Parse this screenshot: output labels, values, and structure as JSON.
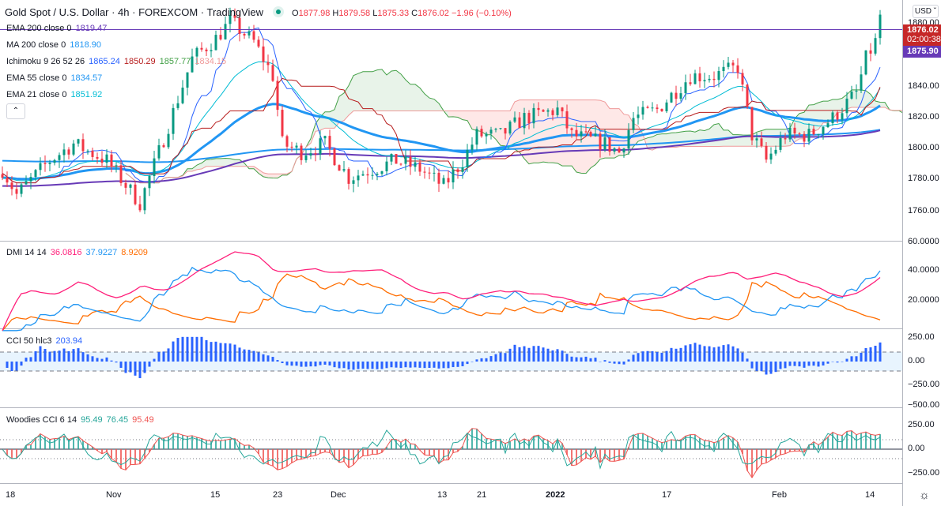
{
  "header": {
    "title": "Gold Spot / U.S. Dollar · 4h · FOREXCOM · TradingView",
    "open_label": "O",
    "open": "1877.98",
    "high_label": "H",
    "high": "1879.58",
    "low_label": "L",
    "low": "1875.33",
    "close_label": "C",
    "close": "1876.02",
    "change": "−1.96 (−0.10%)"
  },
  "legends": {
    "ema200": {
      "name": "EMA 200 close 0",
      "value": "1819.47"
    },
    "ma200": {
      "name": "MA 200 close 0",
      "value": "1818.90"
    },
    "ichimoku": {
      "name": "Ichimoku 9 26 52 26",
      "v1": "1865.24",
      "v2": "1850.29",
      "v3": "1857.77",
      "v4": "1834.15"
    },
    "ema55": {
      "name": "EMA 55 close 0",
      "value": "1834.57"
    },
    "ema21": {
      "name": "EMA 21 close 0",
      "value": "1851.92"
    },
    "dmi": {
      "name": "DMI 14 14",
      "adx": "36.0816",
      "plus_di": "37.9227",
      "minus_di": "8.9209"
    },
    "cci": {
      "name": "CCI 50 hlc3",
      "value": "203.94"
    },
    "woodies": {
      "name": "Woodies CCI 6 14",
      "v1": "95.49",
      "v2": "76.45",
      "v3": "95.49"
    }
  },
  "price_axis": {
    "currency": "USD",
    "ticks": [
      "1880.00",
      "1840.00",
      "1820.00",
      "1800.00",
      "1780.00",
      "1760.00"
    ],
    "last_price": "1876.02",
    "countdown": "02:00:38",
    "ema200_tag": "1875.90"
  },
  "dmi_axis": [
    "60.0000",
    "40.0000",
    "20.0000"
  ],
  "cci_axis": [
    "250.00",
    "0.00",
    "−250.00",
    "−500.00"
  ],
  "woodies_axis": [
    "250.00",
    "0.00",
    "−250.00"
  ],
  "time_axis": [
    "18",
    "Nov",
    "15",
    "23",
    "Dec",
    "13",
    "21",
    "2022",
    "17",
    "Feb",
    "14"
  ],
  "colors": {
    "up": "#089981",
    "down": "#f23645",
    "ema200": "#673ab7",
    "ma200": "#2196f3",
    "ema55": "#2196f3",
    "ema21": "#00bcd4",
    "tenkan": "#2962ff",
    "kijun": "#b71c1c",
    "adx": "#ff1f7a",
    "plus_di": "#2196f3",
    "minus_di": "#ff6d00",
    "cci": "#2962ff"
  },
  "chart_data": {
    "type": "candlestick",
    "title": "Gold Spot / U.S. Dollar · 4h",
    "ylim": [
      1750,
      1885
    ],
    "approx_close_anchors": [
      [
        0,
        1785
      ],
      [
        3,
        1770
      ],
      [
        10,
        1790
      ],
      [
        15,
        1800
      ],
      [
        22,
        1790
      ],
      [
        29,
        1765
      ],
      [
        33,
        1795
      ],
      [
        40,
        1850
      ],
      [
        45,
        1862
      ],
      [
        48,
        1872
      ],
      [
        53,
        1860
      ],
      [
        57,
        1840
      ],
      [
        59,
        1800
      ],
      [
        63,
        1795
      ],
      [
        68,
        1800
      ],
      [
        73,
        1780
      ],
      [
        78,
        1785
      ],
      [
        83,
        1790
      ],
      [
        88,
        1785
      ],
      [
        93,
        1775
      ],
      [
        97,
        1790
      ],
      [
        100,
        1805
      ],
      [
        105,
        1805
      ],
      [
        110,
        1815
      ],
      [
        117,
        1820
      ],
      [
        120,
        1805
      ],
      [
        127,
        1800
      ],
      [
        130,
        1795
      ],
      [
        133,
        1815
      ],
      [
        138,
        1820
      ],
      [
        145,
        1840
      ],
      [
        150,
        1840
      ],
      [
        155,
        1845
      ],
      [
        158,
        1805
      ],
      [
        161,
        1790
      ],
      [
        165,
        1805
      ],
      [
        170,
        1805
      ],
      [
        175,
        1815
      ],
      [
        180,
        1830
      ],
      [
        182,
        1850
      ],
      [
        184,
        1860
      ],
      [
        185,
        1876.02
      ]
    ],
    "bars": 186
  }
}
